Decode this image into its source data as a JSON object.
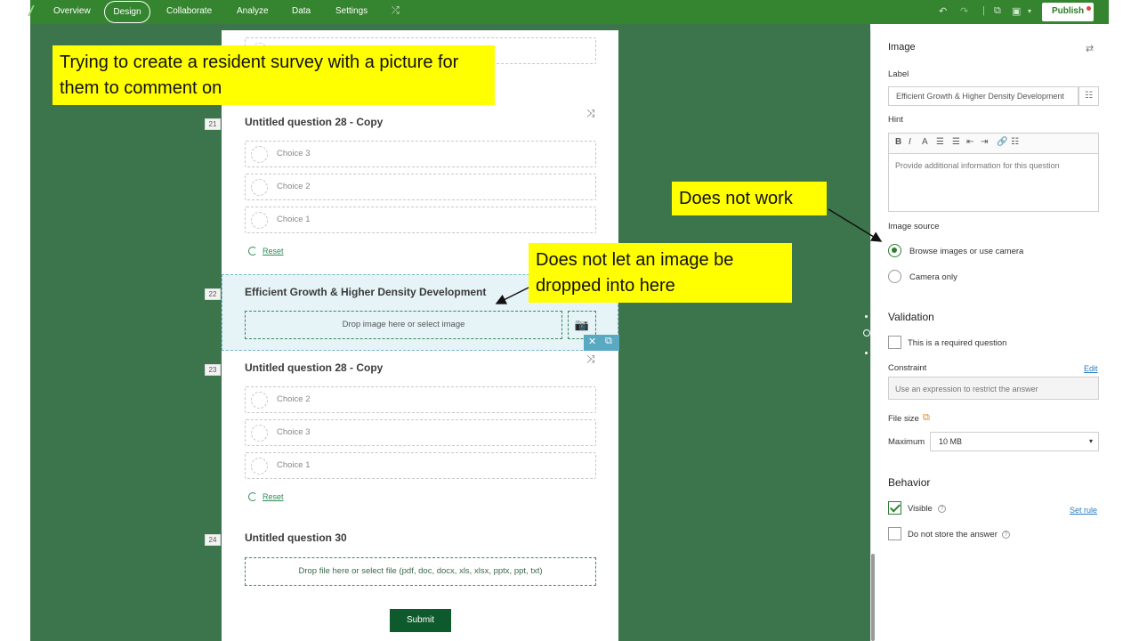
{
  "topbar": {
    "nav": [
      "Overview",
      "Design",
      "Collaborate",
      "Analyze",
      "Data",
      "Settings"
    ],
    "active": "Design",
    "publish_label": "Publish"
  },
  "form": {
    "q21": {
      "number": "21",
      "title": "Untitled question 28 - Copy",
      "choices": [
        "Choice 3",
        "Choice 2",
        "Choice 1"
      ],
      "reset_label": "Reset"
    },
    "q22": {
      "number": "22",
      "title": "Efficient Growth & Higher Density Development",
      "drop_label": "Drop image here or select image"
    },
    "q23": {
      "number": "23",
      "title": "Untitled question 28 - Copy",
      "choices": [
        "Choice 2",
        "Choice 3",
        "Choice 1"
      ],
      "reset_label": "Reset"
    },
    "q24": {
      "number": "24",
      "title": "Untitled question 30",
      "drop_label": "Drop file here or select file (pdf, doc, docx, xls, xlsx, pptx, ppt, txt)"
    },
    "submit_label": "Submit"
  },
  "annotations": {
    "note1": "Trying to create a resident survey with a picture for them to comment on",
    "note2": "Does not work",
    "note3": "Does not let an image be dropped into here"
  },
  "panel": {
    "title": "Image",
    "label_heading": "Label",
    "label_value": "Efficient Growth & Higher Density Development",
    "hint_heading": "Hint",
    "hint_placeholder": "Provide additional information for this question",
    "image_source_heading": "Image source",
    "source_options": [
      "Browse images or use camera",
      "Camera only"
    ],
    "validation_heading": "Validation",
    "required_label": "This is a required question",
    "constraint_heading": "Constraint",
    "constraint_edit": "Edit",
    "constraint_placeholder": "Use an expression to restrict the answer",
    "file_size_heading": "File size",
    "maximum_label": "Maximum",
    "maximum_value": "10 MB",
    "behavior_heading": "Behavior",
    "visible_label": "Visible",
    "set_rule": "Set rule",
    "no_store_label": "Do not store the answer"
  }
}
